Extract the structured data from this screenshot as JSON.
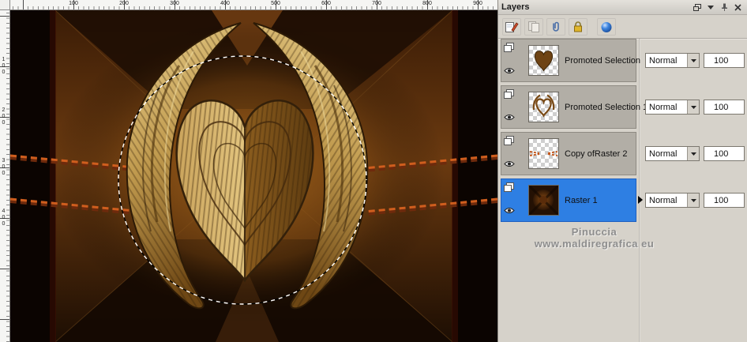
{
  "rulers": {
    "top_labels": [
      "100",
      "200",
      "300",
      "400",
      "500",
      "600",
      "700",
      "800",
      "900"
    ],
    "left_labels": [
      "100",
      "200",
      "300",
      "400"
    ]
  },
  "palette": {
    "title": "Layers",
    "header_icons": [
      "restore-icon",
      "menu-chevron-icon",
      "pin-icon",
      "close-icon"
    ],
    "toolbar_icons": [
      "new-layer",
      "delete-layer",
      "link-layers",
      "lock-transparency",
      "edit-selection"
    ],
    "layers": [
      {
        "name": "Promoted Selection",
        "blend_mode": "Normal",
        "opacity": "100",
        "selected": false,
        "visible": true
      },
      {
        "name": "Promoted Selection 1",
        "blend_mode": "Normal",
        "opacity": "100",
        "selected": false,
        "visible": true
      },
      {
        "name": "Copy ofRaster 2",
        "blend_mode": "Normal",
        "opacity": "100",
        "selected": false,
        "visible": true
      },
      {
        "name": "Raster 1",
        "blend_mode": "Normal",
        "opacity": "100",
        "selected": true,
        "visible": true
      }
    ],
    "dropdown_arrow": "▼",
    "watermark": {
      "line1": "Pinuccia",
      "line2": "www.maldiregrafica.eu"
    }
  },
  "colors": {
    "selected_layer": "#2e7fe3",
    "palette_bg": "#d6d2ca",
    "canvas_gold": "#c9a050",
    "canvas_dark": "#1b0d03",
    "rope_orange": "#cf5e1e"
  }
}
